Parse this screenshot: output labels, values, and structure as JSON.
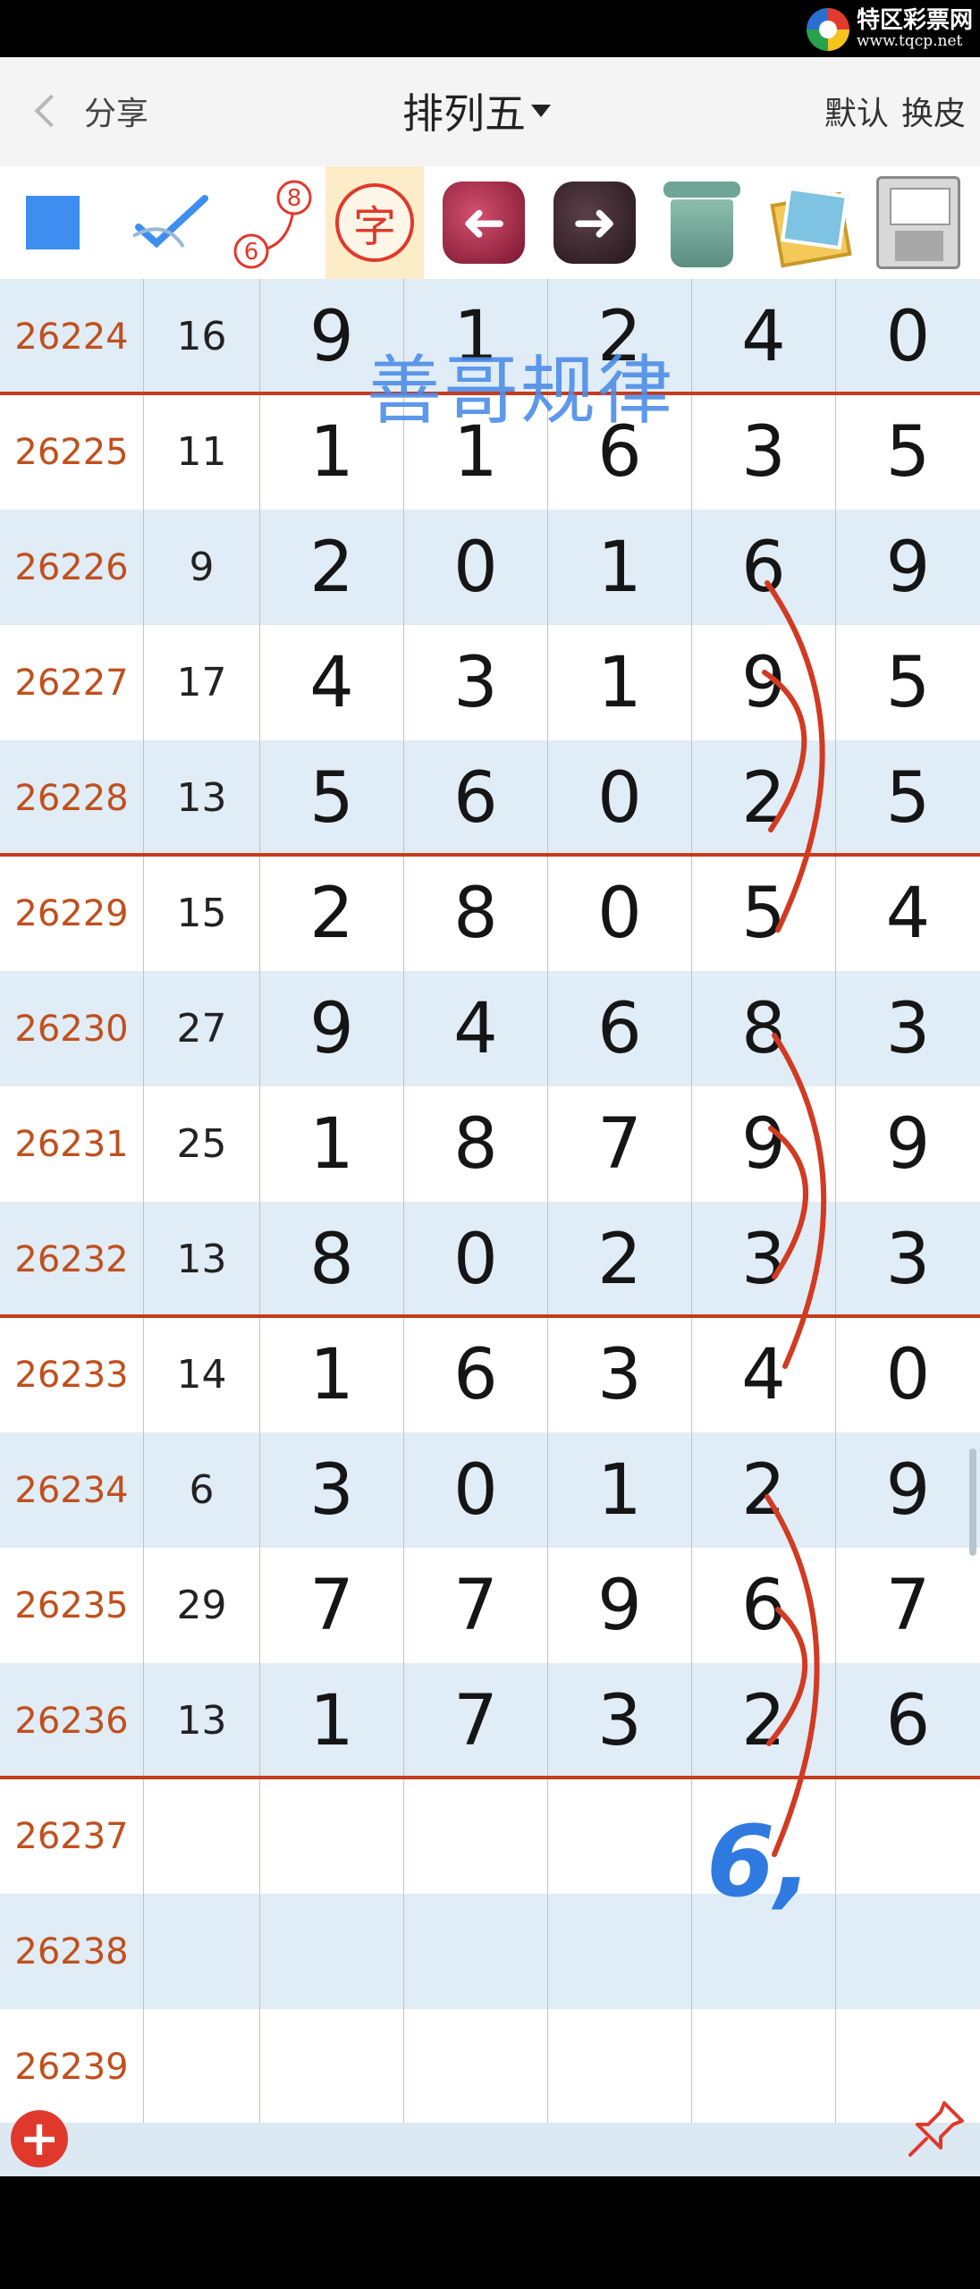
{
  "watermark": {
    "site_name": "特区彩票网",
    "url": "www.tqcp.net"
  },
  "navbar": {
    "back_label": "分享",
    "title": "排列五",
    "right_1": "默认",
    "right_2": "换皮"
  },
  "toolbar": {
    "tools": [
      {
        "name": "color-square",
        "color": "#3d8ef0"
      },
      {
        "name": "check-pen"
      },
      {
        "name": "connect-6-8",
        "num_a": "6",
        "num_b": "8"
      },
      {
        "name": "char-toggle",
        "glyph": "字"
      },
      {
        "name": "previous",
        "glyph": "➜"
      },
      {
        "name": "next",
        "glyph": "➜"
      },
      {
        "name": "trash"
      },
      {
        "name": "photos"
      },
      {
        "name": "save-floppy"
      }
    ]
  },
  "overlay": {
    "text": "善哥规律",
    "color": "#4d8de8"
  },
  "table": {
    "rows": [
      {
        "issue": "26224",
        "sum": "16",
        "d1": "9",
        "d2": "1",
        "d3": "2",
        "d4": "4",
        "d5": "0"
      },
      {
        "issue": "26225",
        "sum": "11",
        "d1": "1",
        "d2": "1",
        "d3": "6",
        "d4": "3",
        "d5": "5"
      },
      {
        "issue": "26226",
        "sum": "9",
        "d1": "2",
        "d2": "0",
        "d3": "1",
        "d4": "6",
        "d5": "9"
      },
      {
        "issue": "26227",
        "sum": "17",
        "d1": "4",
        "d2": "3",
        "d3": "1",
        "d4": "9",
        "d5": "5"
      },
      {
        "issue": "26228",
        "sum": "13",
        "d1": "5",
        "d2": "6",
        "d3": "0",
        "d4": "2",
        "d5": "5"
      },
      {
        "issue": "26229",
        "sum": "15",
        "d1": "2",
        "d2": "8",
        "d3": "0",
        "d4": "5",
        "d5": "4"
      },
      {
        "issue": "26230",
        "sum": "27",
        "d1": "9",
        "d2": "4",
        "d3": "6",
        "d4": "8",
        "d5": "3"
      },
      {
        "issue": "26231",
        "sum": "25",
        "d1": "1",
        "d2": "8",
        "d3": "7",
        "d4": "9",
        "d5": "9"
      },
      {
        "issue": "26232",
        "sum": "13",
        "d1": "8",
        "d2": "0",
        "d3": "2",
        "d4": "3",
        "d5": "3"
      },
      {
        "issue": "26233",
        "sum": "14",
        "d1": "1",
        "d2": "6",
        "d3": "3",
        "d4": "4",
        "d5": "0"
      },
      {
        "issue": "26234",
        "sum": "6",
        "d1": "3",
        "d2": "0",
        "d3": "1",
        "d4": "2",
        "d5": "9"
      },
      {
        "issue": "26235",
        "sum": "29",
        "d1": "7",
        "d2": "7",
        "d3": "9",
        "d4": "6",
        "d5": "7"
      },
      {
        "issue": "26236",
        "sum": "13",
        "d1": "1",
        "d2": "7",
        "d3": "3",
        "d4": "2",
        "d5": "6"
      },
      {
        "issue": "26237",
        "sum": "",
        "d1": "",
        "d2": "",
        "d3": "",
        "d4": "",
        "d5": ""
      },
      {
        "issue": "26238",
        "sum": "",
        "d1": "",
        "d2": "",
        "d3": "",
        "d4": "",
        "d5": ""
      },
      {
        "issue": "26239",
        "sum": "",
        "d1": "",
        "d2": "",
        "d3": "",
        "d4": "",
        "d5": ""
      }
    ]
  },
  "annotations": {
    "handwritten_prediction": "6,"
  },
  "footer": {
    "add_glyph": "+"
  }
}
